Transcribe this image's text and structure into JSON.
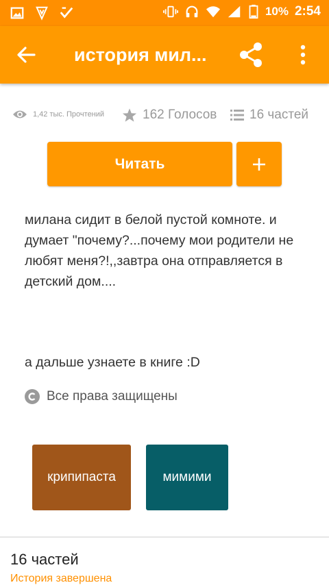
{
  "status_bar": {
    "battery_percent": "10%",
    "time": "2:54",
    "icons": [
      "gallery-icon",
      "shield-app-icon",
      "check-app-icon",
      "vibrate-icon",
      "headphones-icon",
      "wifi-icon",
      "signal-icon",
      "battery-icon"
    ]
  },
  "app_bar": {
    "title": "история мил...",
    "icons": [
      "back-arrow-icon",
      "share-icon",
      "more-vert-icon"
    ]
  },
  "stats": {
    "reads": "1,42 тыс. Прочтений",
    "votes": "162 Голосов",
    "parts": "16 частей"
  },
  "actions": {
    "read_label": "Читать",
    "add_label": "+"
  },
  "description": {
    "paragraph1": "милана сидит в белой пустой комноте. и думает \"почему?...почему мои родители не любят меня?!,,завтра она отправляется в детский дом....",
    "paragraph2": "а дальше узнаете в книге :D"
  },
  "rights": "Все права защищены",
  "tags": [
    {
      "label": "крипипаста",
      "color": "#a0561a"
    },
    {
      "label": "мимими",
      "color": "#075e67"
    }
  ],
  "parts_section": {
    "title": "16 частей",
    "status": "История завершена"
  },
  "colors": {
    "accent": "#ff9800",
    "status_bar": "#ff8f00"
  }
}
